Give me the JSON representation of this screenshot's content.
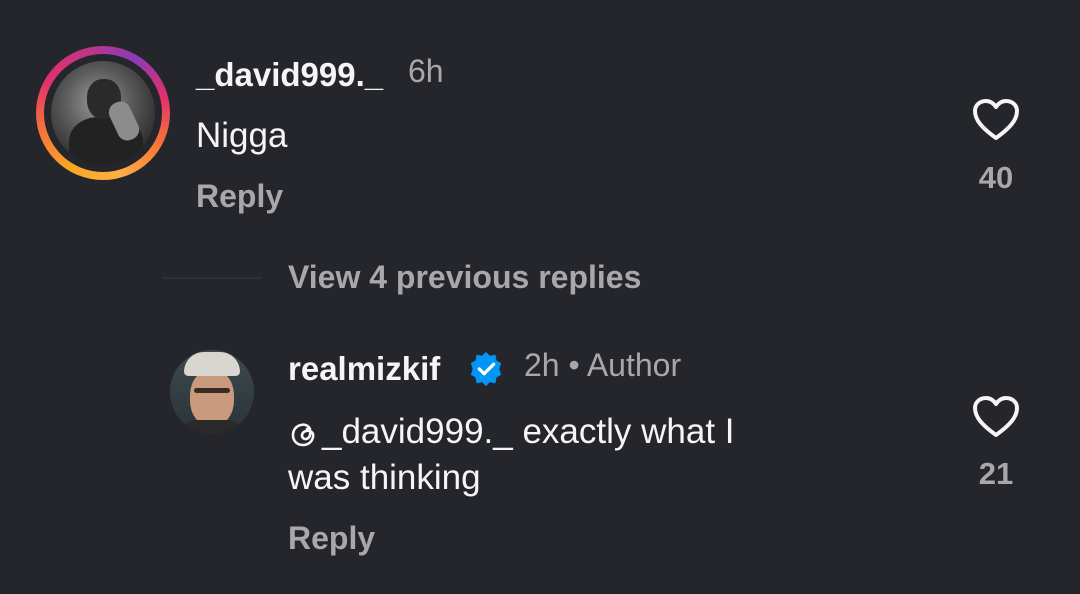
{
  "comments": [
    {
      "username": "_david999._",
      "time": "6h",
      "text": "Nigga",
      "reply_label": "Reply",
      "likes": "40",
      "avatar_has_story_ring": true
    },
    {
      "username": "realmizkif",
      "verified": true,
      "time": "2h",
      "separator": "•",
      "role": "Author",
      "mention": "_david999._",
      "text_line1": " exactly what I",
      "text_line2": "was thinking",
      "reply_label": "Reply",
      "likes": "21"
    }
  ],
  "view_replies_label": "View 4 previous replies",
  "icons": {
    "like": "heart-outline-icon",
    "verified": "verified-badge-icon",
    "mention": "threads-mention-icon"
  },
  "colors": {
    "background": "#25262b",
    "primary_text": "#f5f5f5",
    "secondary_text": "#a8a8a8",
    "verified_blue": "#0095f6"
  }
}
